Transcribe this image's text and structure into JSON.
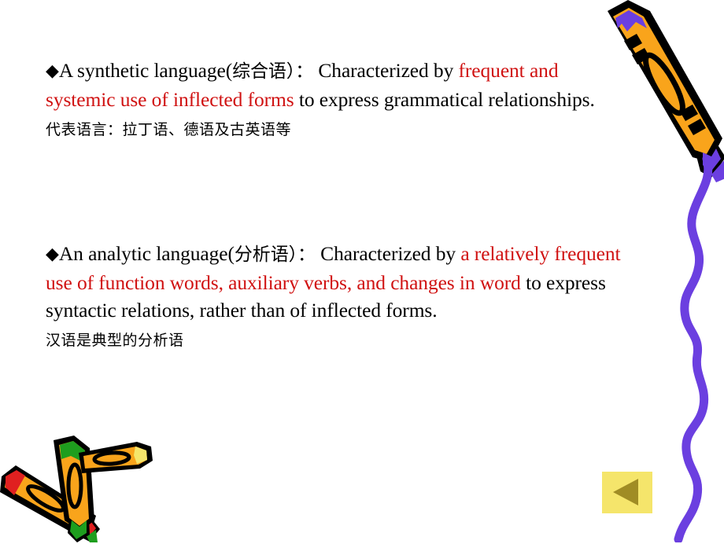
{
  "slide": {
    "background_color": "#FFFFFF",
    "accent_red": "#D01111",
    "accent_purple": "#6B3FE0",
    "crayon_yellow": "#F9A41B",
    "button_yellow": "#F5E56B",
    "button_arrow_color": "#A08C24"
  },
  "bullets": {
    "marker": "◆"
  },
  "paragraph1": {
    "segment_black_1": "A synthetic language(",
    "segment_cn_1": "综合语）：",
    "segment_black_2": " Characterized by ",
    "segment_red": "frequent and systemic use of inflected forms",
    "segment_black_3": " to express grammatical relationships.",
    "subline": "代表语言：拉丁语、德语及古英语等"
  },
  "paragraph2": {
    "segment_black_1": "An analytic language(",
    "segment_cn_1": "分析语）：",
    "segment_black_2": " Characterized by ",
    "segment_red": "a relatively frequent use of function words, auxiliary verbs, and changes in word",
    "segment_black_3": " to express syntactic relations, rather than of inflected forms.",
    "subline": "汉语是典型的分析语"
  },
  "nav": {
    "previous_label": "◀"
  },
  "decorations": {
    "crayon_top_right": "crayon-purple-tip",
    "squiggle_right": "purple-wavy-line",
    "crayons_bottom_left": "crossed-crayons-red-green"
  }
}
